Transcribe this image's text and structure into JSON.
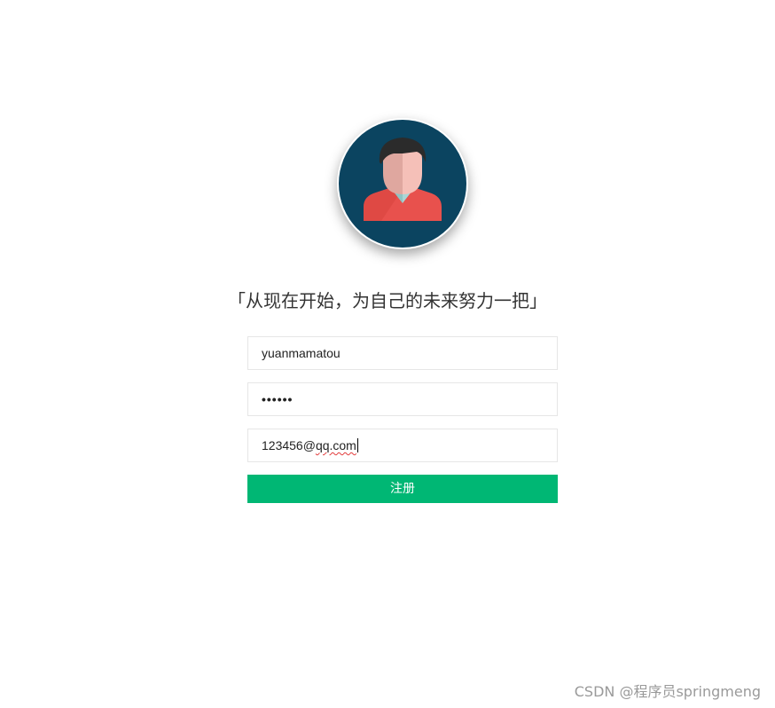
{
  "avatar": {
    "icon": "user-avatar-icon",
    "colors": {
      "background": "#0b4460",
      "hair": "#2b2b2b",
      "face_light": "#f5c0b8",
      "face_shadow": "#dfa79f",
      "collar": "#a9d6d6",
      "shirt": "#e8514d"
    }
  },
  "slogan": "「从现在开始，为自己的未来努力一把」",
  "form": {
    "username_value": "yuanmamatou",
    "password_value": "••••••",
    "email_prefix": "123456@",
    "email_suffix": "qq.com",
    "submit_label": "注册"
  },
  "watermark": "CSDN @程序员springmeng",
  "colors": {
    "accent": "#00b774",
    "border": "#e6e6e6"
  }
}
